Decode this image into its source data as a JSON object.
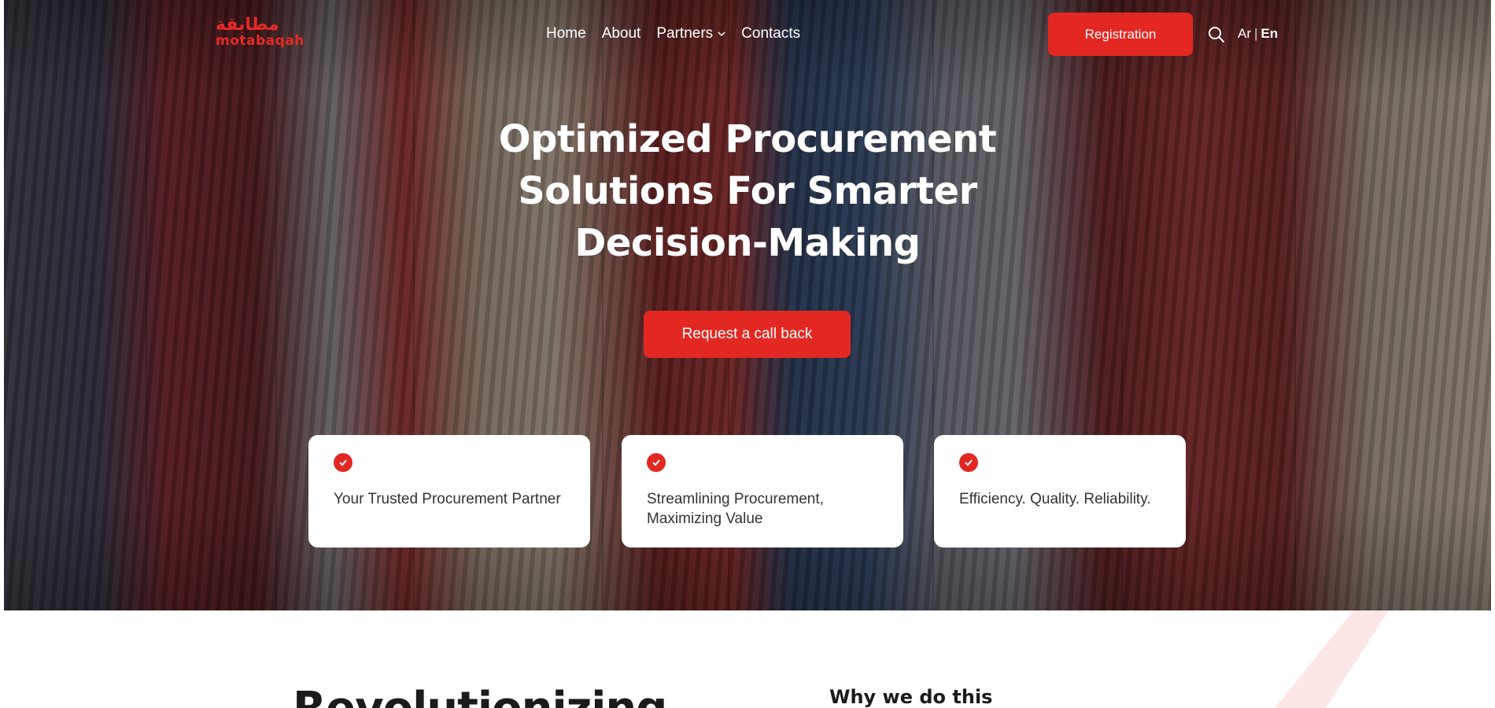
{
  "brand": {
    "logo_ar": "مطابقة",
    "logo_en": "motabaqah",
    "accent": "#e32823"
  },
  "nav": {
    "items": [
      {
        "label": "Home"
      },
      {
        "label": "About"
      },
      {
        "label": "Partners",
        "has_dropdown": true
      },
      {
        "label": "Contacts"
      }
    ],
    "register_label": "Registration",
    "search_icon": "search-icon",
    "lang": {
      "ar": "Ar",
      "sep": "|",
      "en": "En",
      "active": "En"
    }
  },
  "hero": {
    "headline": [
      "Optimized Procurement",
      "Solutions For Smarter",
      "Decision-Making"
    ],
    "cta_label": "Request a call back",
    "cards": [
      {
        "icon": "check-icon",
        "text": "Your Trusted Procurement Partner"
      },
      {
        "icon": "check-icon",
        "text": "Streamlining Procurement, Maximizing Value"
      },
      {
        "icon": "check-icon",
        "text": "Efficiency. Quality. Reliability."
      }
    ]
  },
  "section": {
    "heading_partial": "Revolutionizing",
    "why_heading": "Why we do this"
  }
}
